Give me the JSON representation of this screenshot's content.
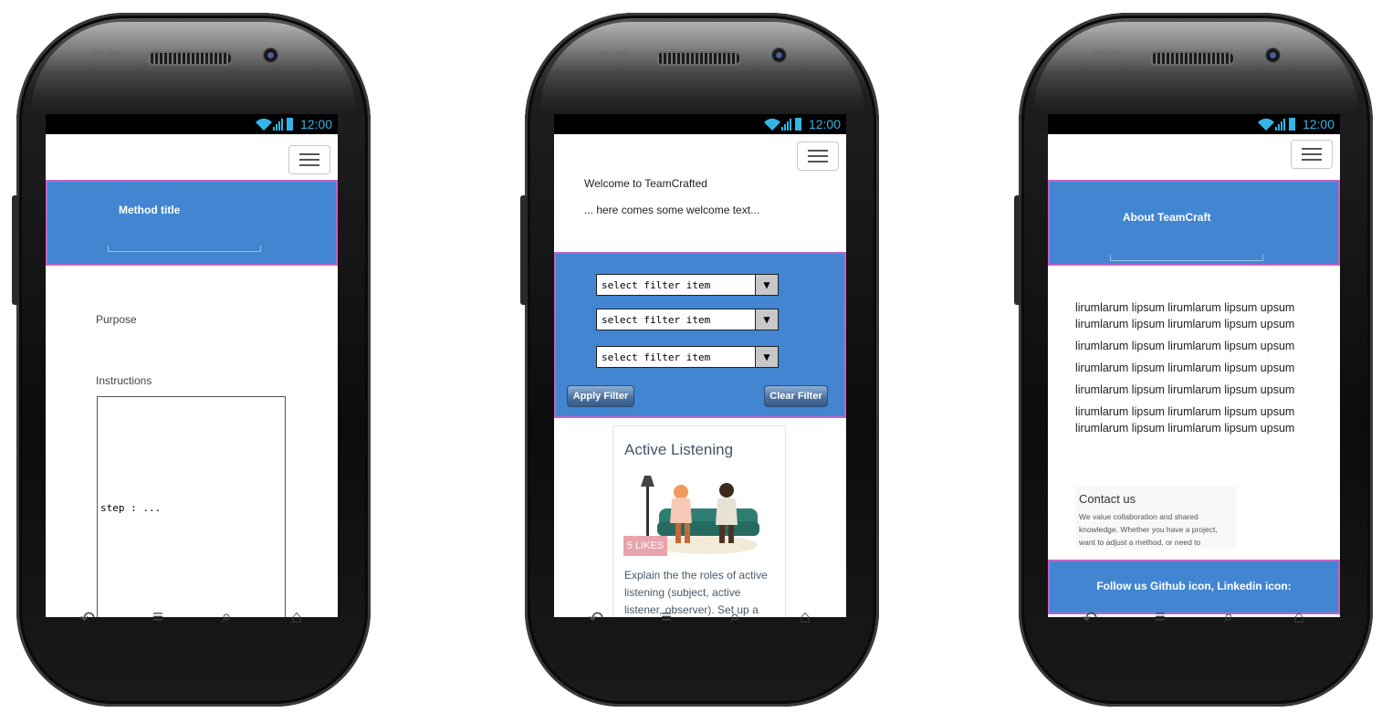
{
  "status": {
    "time": "12:00"
  },
  "phone1": {
    "header_title": "Method title",
    "purpose_label": "Purpose",
    "instructions_label": "Instructions",
    "step_text": "step : ..."
  },
  "phone2": {
    "welcome_title": "Welcome to TeamCrafted",
    "welcome_text": "... here comes some welcome text...",
    "filters": [
      "select filter item",
      "select filter item",
      "select filter item"
    ],
    "apply_label": "Apply Filter",
    "clear_label": "Clear Filter",
    "card": {
      "title": "Active Listening",
      "likes": "5 LIKES",
      "desc_lines": [
        "Explain the the roles of active",
        "listening (subject, active",
        "listener, observer). Set up a"
      ]
    }
  },
  "phone3": {
    "header_title": "About TeamCraft",
    "lorem_lines": [
      "lirumlarum lipsum lirumlarum lipsum upsum",
      "lirumlarum lipsum lirumlarum lipsum upsum",
      "lirumlarum lipsum lirumlarum lipsum upsum",
      "lirumlarum lipsum lirumlarum lipsum upsum",
      "lirumlarum lipsum lirumlarum lipsum upsum",
      "lirumlarum lipsum lirumlarum lipsum upsum",
      "lirumlarum lipsum lirumlarum lipsum upsum"
    ],
    "contact_title": "Contact us",
    "contact_lines": [
      "We value collaboration and shared",
      "knowledge. Whether you have a project,",
      "want to adjust a method, or need to"
    ],
    "footer_text": "Follow us Github icon, Linkedin icon:"
  },
  "colors": {
    "accent": "#4286d2",
    "frame": "#c066c8",
    "status_text": "#33b5e5"
  },
  "icons": [
    "wifi-icon",
    "signal-icon",
    "battery-icon",
    "menu-icon",
    "back-icon",
    "menu-key-icon",
    "search-key-icon",
    "home-icon",
    "dropdown-arrow-icon"
  ]
}
